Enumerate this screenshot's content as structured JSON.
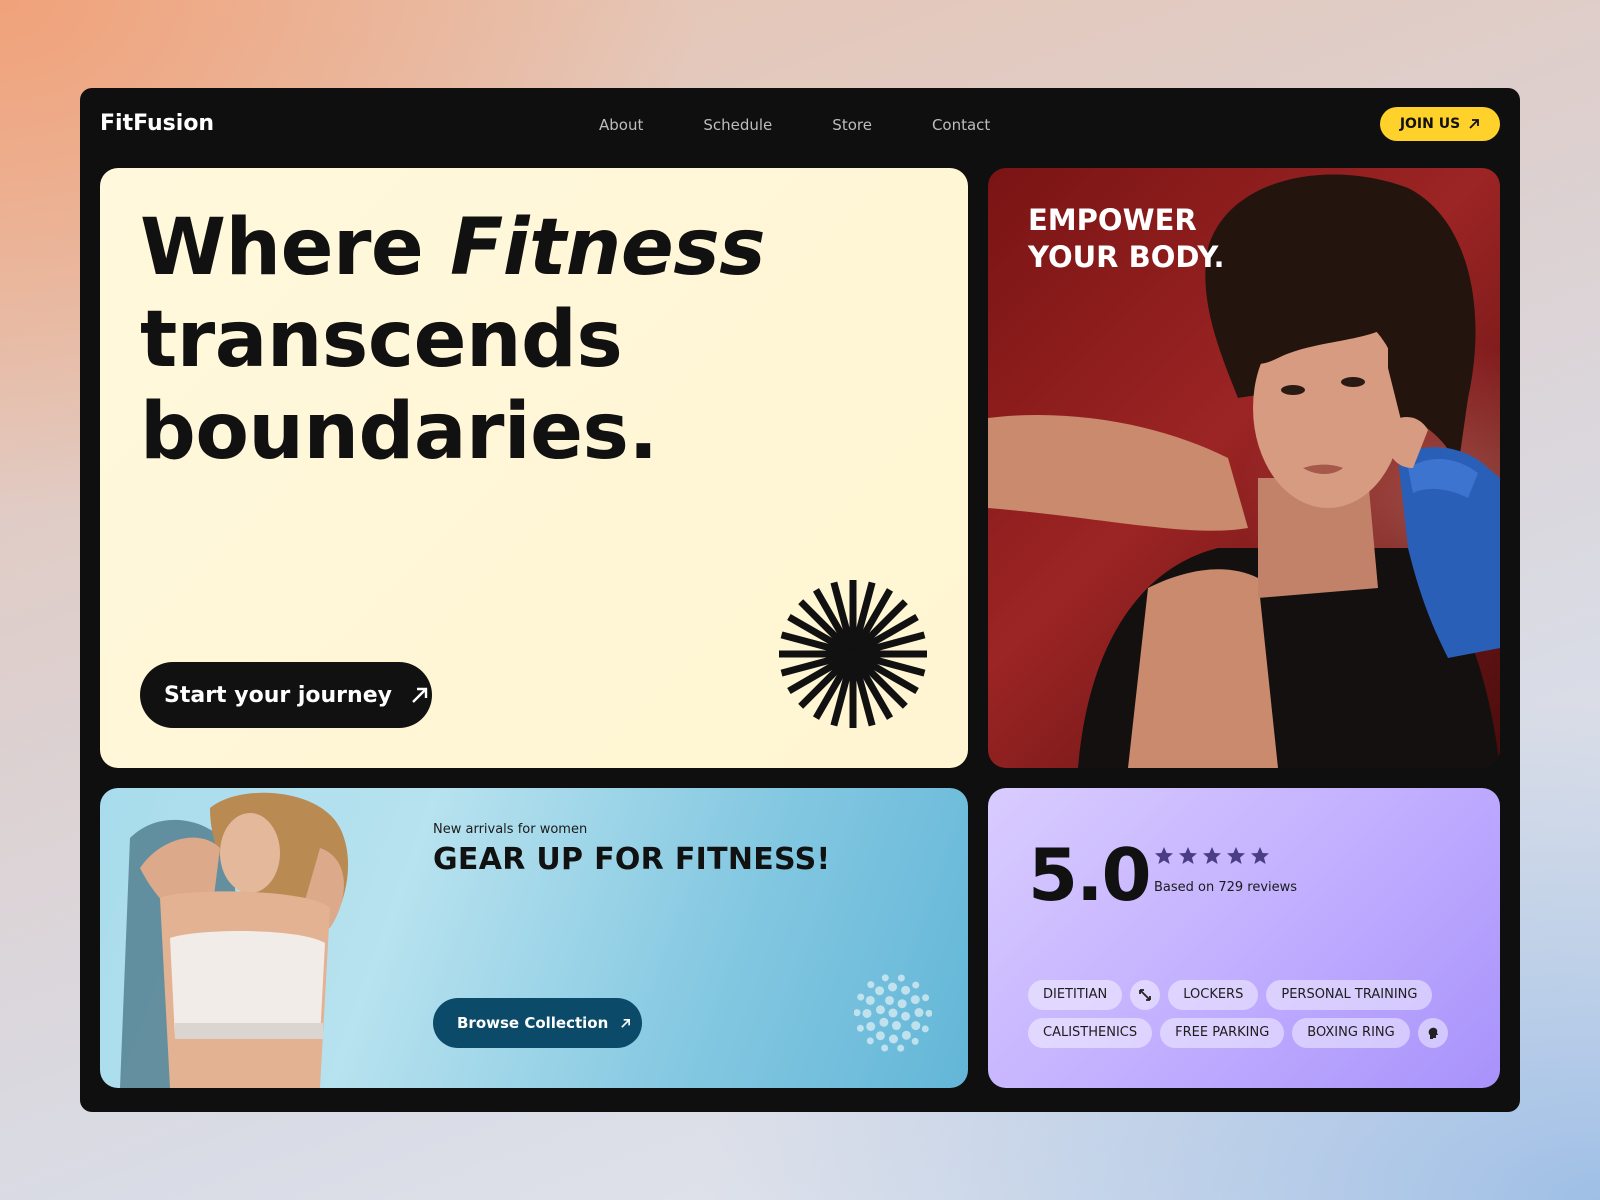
{
  "brand": {
    "name": "FitFusion"
  },
  "nav": {
    "items": [
      {
        "label": "About"
      },
      {
        "label": "Schedule"
      },
      {
        "label": "Store"
      },
      {
        "label": "Contact"
      }
    ],
    "cta_label": "JOIN US"
  },
  "hero": {
    "title_part1": "Where ",
    "title_emphasis": "Fitness",
    "title_line2": "transcends",
    "title_line3": "boundaries.",
    "button_label": "Start your journey"
  },
  "promo": {
    "title": "EMPOWER YOUR BODY."
  },
  "gear": {
    "kicker": "New arrivals for women",
    "title": "GEAR UP FOR FITNESS!",
    "button_label": "Browse Collection"
  },
  "rating": {
    "score": "5.0",
    "stars": 5,
    "reviews_text": "Based on 729 reviews",
    "tags_row1": [
      "DIETITIAN",
      "LOCKERS",
      "PERSONAL TRAINING"
    ],
    "tags_row2": [
      "CALISTHENICS",
      "FREE PARKING",
      "BOXING RING"
    ]
  },
  "icons": {
    "cta": "arrow-up-right-icon",
    "burst": "starburst-icon",
    "rating_stars": "star-icon",
    "tag_row1": "expand-arrows-icon",
    "tag_row2": "head-profile-icon"
  },
  "colors": {
    "accent_yellow": "#ffd12b",
    "panel_bg": "#0f0f0f",
    "hero_bg": "#fff8dc",
    "gear_button": "#0b4b69",
    "rating_bg": "#c3b0ff",
    "star_color": "#4a3d86"
  }
}
